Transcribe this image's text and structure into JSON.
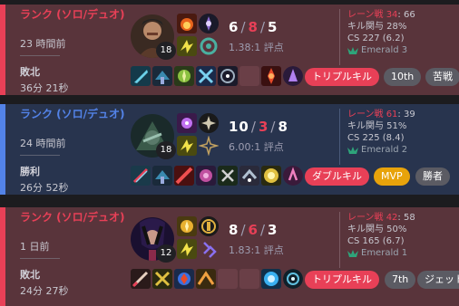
{
  "matches": [
    {
      "queue": "ランク (ソロ/デュオ)",
      "time_ago": "23 時間前",
      "result": "敗北",
      "duration": "36分 21秒",
      "level": "18",
      "kills": "6",
      "deaths": "8",
      "assists": "5",
      "kda_ratio": "1.38:1 評点",
      "lane_label": "レーン戦",
      "lane_score": "34",
      "lane_vs": ": 66",
      "kp": "キル関与 28%",
      "cs": "CS 227 (6.2)",
      "tier": "Emerald 3",
      "badges": [
        "トリプルキル",
        "10th",
        "苦戦"
      ]
    },
    {
      "queue": "ランク (ソロ/デュオ)",
      "time_ago": "24 時間前",
      "result": "勝利",
      "duration": "26分 52秒",
      "level": "18",
      "kills": "10",
      "deaths": "3",
      "assists": "8",
      "kda_ratio": "6.00:1 評点",
      "lane_label": "レーン戦",
      "lane_score": "61",
      "lane_vs": ": 39",
      "kp": "キル関与 51%",
      "cs": "CS 225 (8.4)",
      "tier": "Emerald 2",
      "badges": [
        "ダブルキル",
        "MVP",
        "勝者"
      ]
    },
    {
      "queue": "ランク (ソロ/デュオ)",
      "time_ago": "1 日前",
      "result": "敗北",
      "duration": "24分 27秒",
      "level": "12",
      "kills": "8",
      "deaths": "6",
      "assists": "3",
      "kda_ratio": "1.83:1 評点",
      "lane_label": "レーン戦",
      "lane_score": "42",
      "lane_vs": ": 58",
      "kp": "キル関与 50%",
      "cs": "CS 165 (6.7)",
      "tier": "Emerald 1",
      "badges": [
        "トリプルキル",
        "7th",
        "ジェット"
      ]
    }
  ],
  "icons": {
    "champion": "champion-portrait-icon",
    "summoner_spell": "summoner-spell-icon",
    "rune": "rune-icon",
    "item": "item-icon",
    "ward": "ward-trinket-icon",
    "tier": "emerald-tier-icon"
  },
  "colors": {
    "loss_bg": "#59343b",
    "loss_accent": "#e84057",
    "win_bg": "#28344e",
    "win_accent": "#5383e8",
    "mvp": "#e8a30b",
    "emerald": "#2ea47a"
  }
}
